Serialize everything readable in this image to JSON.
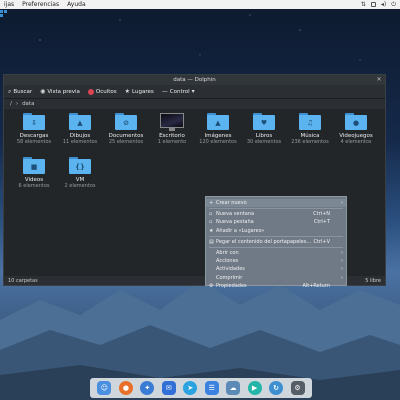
{
  "topbar": {
    "menus": [
      "ijas",
      "Preferencias",
      "Ayuda"
    ]
  },
  "window": {
    "title": "data — Dolphin",
    "toolbar": {
      "search": "Buscar",
      "preview": "Vista previa",
      "hidden": "Ocultos",
      "places": "Lugares",
      "control": "Control"
    },
    "breadcrumb": {
      "sep": "/",
      "current": "data"
    },
    "items": [
      {
        "name": "Descargas",
        "count": "58 elementos",
        "icon": "download-icon",
        "glyph": "⇩"
      },
      {
        "name": "Dibujos",
        "count": "11 elementos",
        "icon": "image-folder-icon",
        "glyph": "▲"
      },
      {
        "name": "Documentos",
        "count": "25 elementos",
        "icon": "paperclip-icon",
        "glyph": "⊘"
      },
      {
        "name": "Escritorio",
        "count": "1 elemento",
        "icon": "desktop-icon",
        "glyph": ""
      },
      {
        "name": "Imágenes",
        "count": "120 elementos",
        "icon": "pictures-icon",
        "glyph": "▲"
      },
      {
        "name": "Libros",
        "count": "30 elementos",
        "icon": "heart-icon",
        "glyph": "♥"
      },
      {
        "name": "Música",
        "count": "236 elementos",
        "icon": "music-icon",
        "glyph": "♫"
      },
      {
        "name": "Videojuegos",
        "count": "4 elementos",
        "icon": "github-icon",
        "glyph": "●"
      },
      {
        "name": "Videos",
        "count": "6 elementos",
        "icon": "video-icon",
        "glyph": "■"
      },
      {
        "name": "VM",
        "count": "2 elementos",
        "icon": "braces-icon",
        "glyph": "{}"
      }
    ],
    "status": {
      "left": "10 carpetas",
      "right": "5 libre"
    }
  },
  "context_menu": {
    "items": [
      {
        "label": "Crear nuevo",
        "shortcut": "",
        "arrow": "›"
      },
      {
        "label": "Nueva ventana",
        "shortcut": "Ctrl+N",
        "arrow": ""
      },
      {
        "label": "Nueva pestaña",
        "shortcut": "Ctrl+T",
        "arrow": ""
      },
      {
        "label": "Añadir a «Lugares»",
        "shortcut": "",
        "arrow": ""
      },
      {
        "label": "Pegar el contenido del portapapeles...",
        "shortcut": "Ctrl+V",
        "arrow": ""
      },
      {
        "label": "Abrir con",
        "shortcut": "",
        "arrow": "›"
      },
      {
        "label": "Acciones",
        "shortcut": "",
        "arrow": "›"
      },
      {
        "label": "Actividades",
        "shortcut": "",
        "arrow": "›"
      },
      {
        "label": "Comprimir",
        "shortcut": "",
        "arrow": "›"
      },
      {
        "label": "Propiedades",
        "shortcut": "Alt+Return",
        "arrow": ""
      }
    ]
  },
  "dock": {
    "apps": [
      {
        "name": "finder-icon",
        "color": "#4a8fe0"
      },
      {
        "name": "firefox-icon",
        "color": "#e8702a"
      },
      {
        "name": "safari-icon",
        "color": "#3a7bd5"
      },
      {
        "name": "mail-icon",
        "color": "#2f6fd6"
      },
      {
        "name": "telegram-icon",
        "color": "#2aa3e0"
      },
      {
        "name": "notes-icon",
        "color": "#3b82e0"
      },
      {
        "name": "cloud-icon",
        "color": "#5a8ab5"
      },
      {
        "name": "player-icon",
        "color": "#23b5a8"
      },
      {
        "name": "sync-icon",
        "color": "#3d8fd1"
      },
      {
        "name": "settings-icon",
        "color": "#555e66"
      }
    ]
  }
}
